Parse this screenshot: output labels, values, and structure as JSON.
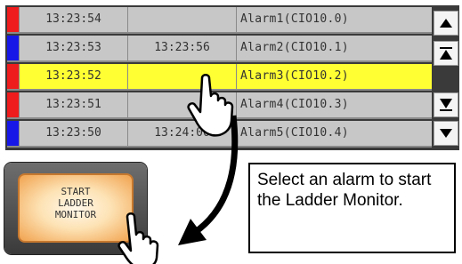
{
  "alarm_table": {
    "rows": [
      {
        "marker_color": "#ee1c1c",
        "occurred": "13:23:54",
        "recovered": "",
        "message": "Alarm1(CIO10.0)",
        "selected": false
      },
      {
        "marker_color": "#1717e8",
        "occurred": "13:23:53",
        "recovered": "13:23:56",
        "message": "Alarm2(CIO10.1)",
        "selected": false
      },
      {
        "marker_color": "#ee1c1c",
        "occurred": "13:23:52",
        "recovered": "",
        "message": "Alarm3(CIO10.2)",
        "selected": true
      },
      {
        "marker_color": "#ee1c1c",
        "occurred": "13:23:51",
        "recovered": "",
        "message": "Alarm4(CIO10.3)",
        "selected": false
      },
      {
        "marker_color": "#1717e8",
        "occurred": "13:23:50",
        "recovered": "13:24:00",
        "message": "Alarm5(CIO10.4)",
        "selected": false
      }
    ]
  },
  "scroll_buttons": [
    {
      "icon": "scroll-up-icon"
    },
    {
      "icon": "page-up-icon"
    },
    {
      "icon": "page-down-icon"
    },
    {
      "icon": "scroll-down-icon"
    }
  ],
  "start_button": {
    "label": "START\nLADDER\nMONITOR"
  },
  "callout": {
    "text": "Select an alarm to start the Ladder Monitor."
  },
  "colors": {
    "selected_row": "#ffff33",
    "row_bg": "#c7c7c7",
    "panel_bg": "#3a3a3a",
    "button_glow": "#f1a24e"
  }
}
